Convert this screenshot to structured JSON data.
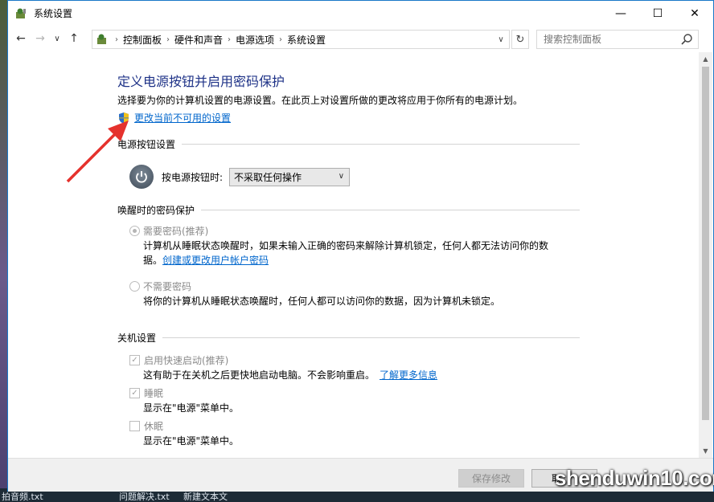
{
  "window": {
    "title": "系统设置",
    "controls": {
      "minimize": "—",
      "maximize": "☐",
      "close": "✕"
    }
  },
  "nav": {
    "back": "←",
    "forward": "→",
    "recent": "∨",
    "up": "↑",
    "breadcrumbs": [
      "控制面板",
      "硬件和声音",
      "电源选项",
      "系统设置"
    ],
    "refresh": "↻",
    "search_placeholder": "搜索控制面板"
  },
  "main": {
    "title": "定义电源按钮并启用密码保护",
    "subtitle": "选择要为你的计算机设置的电源设置。在此页上对设置所做的更改将应用于你所有的电源计划。",
    "change_link": "更改当前不可用的设置"
  },
  "power_section": {
    "heading": "电源按钮设置",
    "button_label": "按电源按钮时:",
    "selected_action": "不采取任何操作"
  },
  "password_section": {
    "heading": "唤醒时的密码保护",
    "require": {
      "label": "需要密码(推荐)",
      "desc_line1": "计算机从睡眠状态唤醒时，如果未输入正确的密码来解除计算机锁定，任何人都无法访问你的数",
      "desc_line2": "据。",
      "link": "创建或更改用户帐户密码",
      "checked": true
    },
    "no_require": {
      "label": "不需要密码",
      "desc": "将你的计算机从睡眠状态唤醒时，任何人都可以访问你的数据，因为计算机未锁定。",
      "checked": false
    }
  },
  "shutdown_section": {
    "heading": "关机设置",
    "fast_startup": {
      "label": "启用快速启动(推荐)",
      "desc": "这有助于在关机之后更快地启动电脑。不会影响重启。",
      "link": "了解更多信息",
      "checked": true
    },
    "sleep": {
      "label": "睡眠",
      "desc": "显示在\"电源\"菜单中。",
      "checked": true
    },
    "hibernate": {
      "label": "休眠",
      "desc": "显示在\"电源\"菜单中。",
      "checked": false
    }
  },
  "footer": {
    "save": "保存修改",
    "cancel": "取"
  },
  "taskbar": {
    "item1": "拍音频.txt",
    "item2": "问题解决.txt",
    "item3": "新建文本文"
  },
  "watermark": "shenduwin10.com",
  "colors": {
    "title_blue": "#1e3287",
    "link_blue": "#0066cc",
    "arrow_red": "#e5322d",
    "window_border": "#1a78c8"
  }
}
